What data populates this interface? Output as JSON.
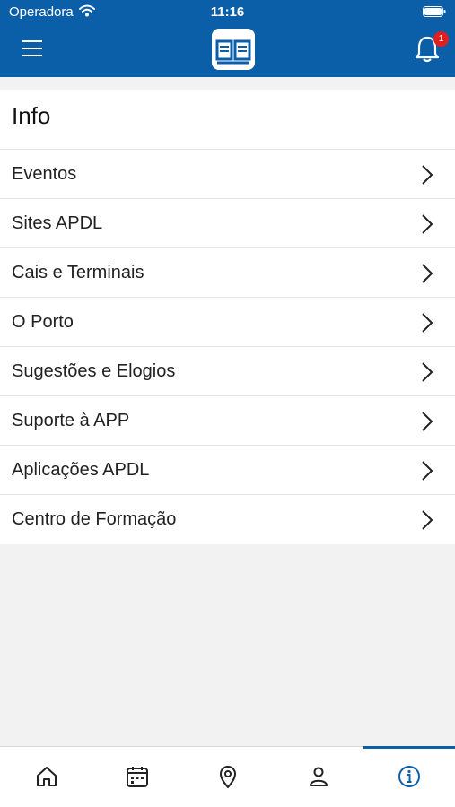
{
  "status_bar": {
    "carrier": "Operadora",
    "time": "11:16"
  },
  "header": {
    "notification_count": "1"
  },
  "info": {
    "title": "Info",
    "items": [
      {
        "label": "Eventos"
      },
      {
        "label": "Sites APDL"
      },
      {
        "label": "Cais e Terminais"
      },
      {
        "label": "O Porto"
      },
      {
        "label": "Sugestões e Elogios"
      },
      {
        "label": "Suporte à APP"
      },
      {
        "label": "Aplicações APDL"
      },
      {
        "label": "Centro de Formação"
      }
    ]
  },
  "tabbar": {
    "tabs": [
      {
        "icon": "home-icon"
      },
      {
        "icon": "calendar-icon"
      },
      {
        "icon": "location-pin-icon"
      },
      {
        "icon": "user-icon"
      },
      {
        "icon": "info-icon",
        "active": true
      }
    ]
  },
  "colors": {
    "brand": "#0b5ea8",
    "badge": "#e02020",
    "background": "#f2f2f2"
  }
}
